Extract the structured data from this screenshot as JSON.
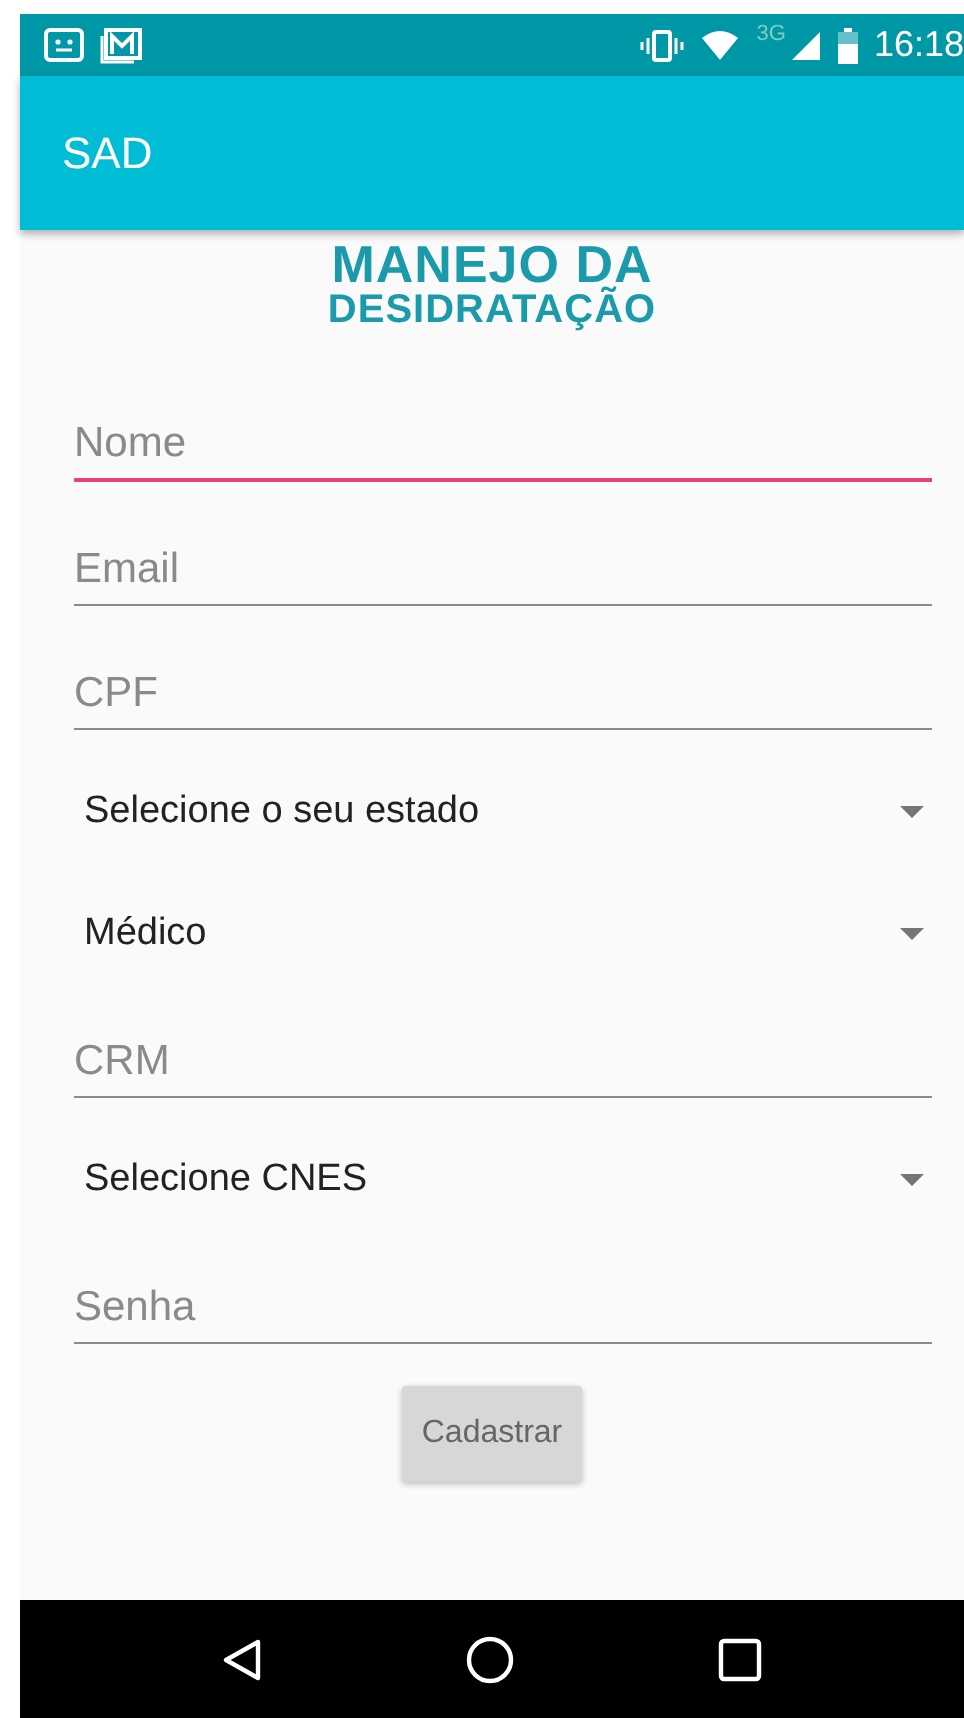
{
  "status_bar": {
    "time": "16:18",
    "network": "3G"
  },
  "app_bar": {
    "title": "SAD"
  },
  "logo": {
    "lines": [
      "MANEJO DA",
      "DESIDRATAÇÃO"
    ]
  },
  "form": [
    {
      "kind": "text",
      "placeholder": "Nome",
      "focused": true
    },
    {
      "kind": "text",
      "placeholder": "Email",
      "focused": false
    },
    {
      "kind": "text",
      "placeholder": "CPF",
      "focused": false
    },
    {
      "kind": "dropdown",
      "value": "Selecione o seu estado"
    },
    {
      "kind": "dropdown",
      "value": "Médico"
    },
    {
      "kind": "text",
      "placeholder": "CRM",
      "focused": false
    },
    {
      "kind": "dropdown",
      "value": "Selecione CNES"
    },
    {
      "kind": "text",
      "placeholder": "Senha",
      "focused": false
    }
  ],
  "submit": {
    "label": "Cadastrar"
  }
}
